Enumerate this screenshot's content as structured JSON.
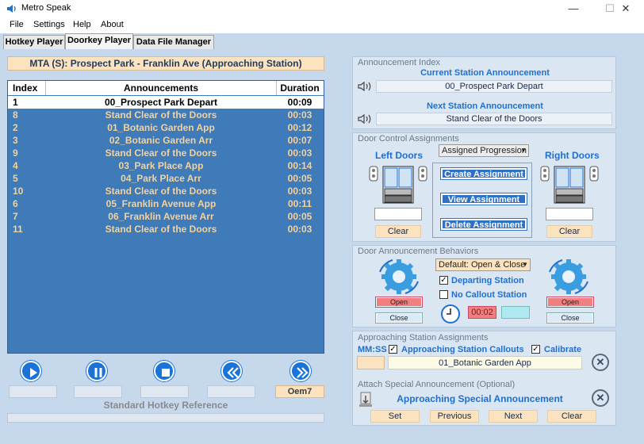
{
  "window": {
    "title": "Metro Speak",
    "minimize": "—",
    "maximize": "☐",
    "close": "✕"
  },
  "menu": [
    "File",
    "Settings",
    "Help",
    "About"
  ],
  "tabs": [
    "Hotkey Player",
    "Doorkey Player",
    "Data File Manager"
  ],
  "now_playing": "MTA (S): Prospect Park - Franklin Ave (Approaching Station)",
  "table": {
    "headers": [
      "Index",
      "Announcements",
      "Duration"
    ],
    "rows": [
      {
        "index": "1",
        "announcement": "00_Prospect Park Depart",
        "duration": "00:09",
        "selected": true
      },
      {
        "index": "8",
        "announcement": "Stand Clear of the Doors",
        "duration": "00:03"
      },
      {
        "index": "2",
        "announcement": "01_Botanic Garden App",
        "duration": "00:12"
      },
      {
        "index": "3",
        "announcement": "02_Botanic Garden Arr",
        "duration": "00:07"
      },
      {
        "index": "9",
        "announcement": "Stand Clear of the Doors",
        "duration": "00:03"
      },
      {
        "index": "4",
        "announcement": "03_Park Place App",
        "duration": "00:14"
      },
      {
        "index": "5",
        "announcement": "04_Park Place Arr",
        "duration": "00:05"
      },
      {
        "index": "10",
        "announcement": "Stand Clear of the Doors",
        "duration": "00:03"
      },
      {
        "index": "6",
        "announcement": "05_Franklin Avenue App",
        "duration": "00:11"
      },
      {
        "index": "7",
        "announcement": "06_Franklin Avenue Arr",
        "duration": "00:05"
      },
      {
        "index": "11",
        "announcement": "Stand Clear of the Doors",
        "duration": "00:03"
      }
    ]
  },
  "player": {
    "buttons": [
      "play-icon",
      "pause-icon",
      "stop-icon",
      "rewind-icon",
      "fast-forward-icon"
    ],
    "hotkey_last": "Oem7",
    "hotkey_reference": "Standard Hotkey Reference"
  },
  "announcement_index": {
    "title": "Announcement Index",
    "current_label": "Current Station Announcement",
    "current_value": "00_Prospect Park Depart",
    "next_label": "Next Station Announcement",
    "next_value": "Stand Clear of the Doors"
  },
  "door_control": {
    "title": "Door Control Assignments",
    "left_label": "Left Doors",
    "right_label": "Right Doors",
    "mode_select": "Assigned Progression",
    "create": "Create Assignment",
    "view": "View Assignment",
    "delete": "Delete Assignment",
    "clear_left": "Clear",
    "clear_right": "Clear"
  },
  "door_behaviors": {
    "title": "Door Announcement Behaviors",
    "select": "Default: Open & Close",
    "departing": {
      "label": "Departing Station",
      "checked": "✓"
    },
    "no_callout": {
      "label": "No Callout Station",
      "checked": ""
    },
    "timer": "00:02",
    "left_open": "Open",
    "left_close": "Close",
    "right_open": "Open",
    "right_close": "Close"
  },
  "approaching": {
    "title": "Approaching Station Assignments",
    "mmss": "MM:SS",
    "callouts": {
      "label": "Approaching Station Callouts",
      "checked": "✓"
    },
    "calibrate": {
      "label": "Calibrate",
      "checked": "✓"
    },
    "value": "01_Botanic Garden App",
    "remove": "✕"
  },
  "special": {
    "title": "Attach Special Announcement (Optional)",
    "value": "Approaching Special Announcement",
    "remove": "✕",
    "set": "Set",
    "previous": "Previous",
    "next": "Next",
    "clear": "Clear"
  },
  "colors": {
    "list_bg": "#3f7ab9",
    "accent_orange": "#fbe3bf",
    "open_red": "#f08080",
    "panel": "#dbe6f3"
  }
}
